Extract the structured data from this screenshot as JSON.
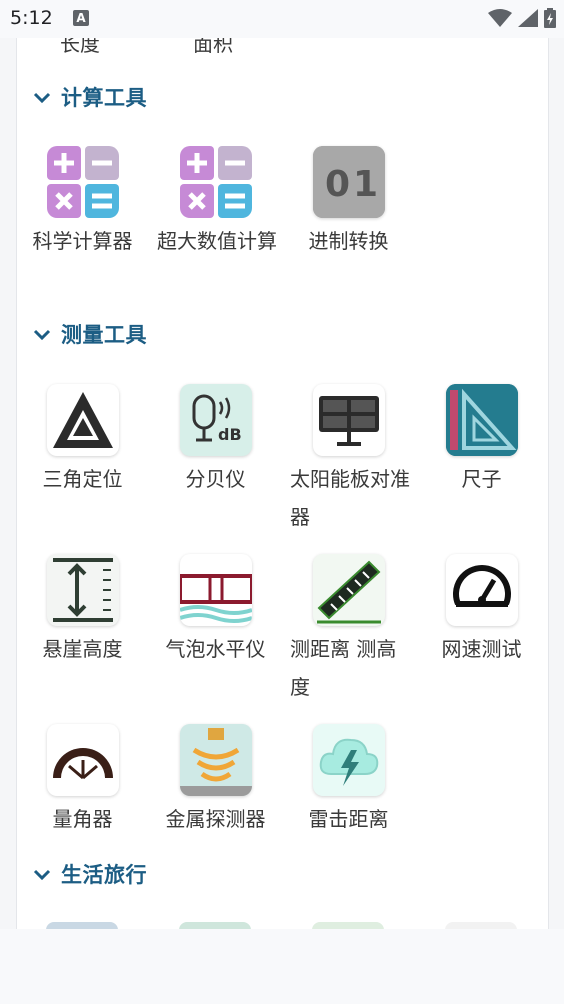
{
  "status_bar": {
    "time": "5:12",
    "notif_letter": "A"
  },
  "top_cut": {
    "col1": "长度",
    "col2": "面积"
  },
  "sections": [
    {
      "title": "计算工具"
    },
    {
      "title": "测量工具"
    },
    {
      "title": "生活旅行"
    }
  ],
  "calc_tools": [
    {
      "label": "科学计算器",
      "icon": "calculator-icon"
    },
    {
      "label": "超大数值计算",
      "icon": "big-number-calculator-icon"
    },
    {
      "label": "进制转换",
      "icon": "binary-converter-icon"
    }
  ],
  "measure_tools": [
    {
      "label": "三角定位",
      "icon": "triangle-icon"
    },
    {
      "label": "分贝仪",
      "icon": "decibel-meter-icon"
    },
    {
      "label": "太阳能板对准器",
      "icon": "solar-panel-icon"
    },
    {
      "label": "尺子",
      "icon": "ruler-icon"
    },
    {
      "label": "悬崖高度",
      "icon": "cliff-height-icon"
    },
    {
      "label": "气泡水平仪",
      "icon": "bubble-level-icon"
    },
    {
      "label": "测距离 测高度",
      "icon": "distance-ruler-icon"
    },
    {
      "label": "网速测试",
      "icon": "speedometer-icon"
    },
    {
      "label": "量角器",
      "icon": "protractor-icon"
    },
    {
      "label": "金属探测器",
      "icon": "metal-detector-icon"
    },
    {
      "label": "雷击距离",
      "icon": "lightning-cloud-icon"
    }
  ]
}
